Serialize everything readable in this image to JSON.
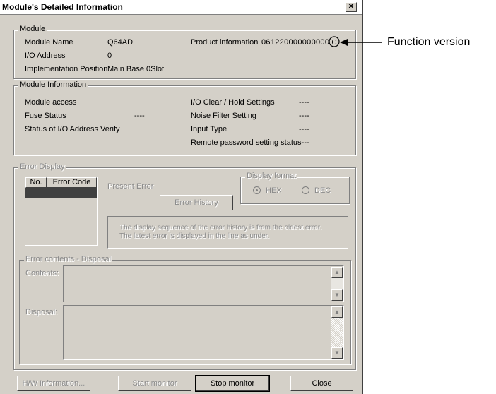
{
  "window": {
    "title": "Module's Detailed Information",
    "close_glyph": "✕"
  },
  "module": {
    "legend": "Module",
    "name_label": "Module Name",
    "name_value": "Q64AD",
    "io_label": "I/O Address",
    "io_value": "0",
    "impl_label": "Implementation Position",
    "impl_value": "Main Base  0Slot",
    "product_label": "Product information",
    "product_value": "061220000000000",
    "version_letter": "C"
  },
  "module_info": {
    "legend": "Module Information",
    "access_label": "Module access",
    "access_value": "",
    "fuse_label": "Fuse Status",
    "fuse_value": "----",
    "verify_label": "Status of I/O Address Verify",
    "verify_value": "",
    "ioclear_label": "I/O Clear / Hold Settings",
    "ioclear_value": "----",
    "noise_label": "Noise Filter Setting",
    "noise_value": "----",
    "input_label": "Input Type",
    "input_value": "----",
    "remote_label": "Remote password setting status",
    "remote_value": "----"
  },
  "error_display": {
    "legend": "Error Display",
    "col_no": "No.",
    "col_code": "Error Code",
    "present_error_label": "Present Error",
    "display_format_legend": "Display format",
    "hex_label": "HEX",
    "dec_label": "DEC",
    "error_history_button": "Error History",
    "note_line1": "The display sequence of the error history is from the oldest error.",
    "note_line2": "The latest error is displayed in the line as under."
  },
  "error_contents": {
    "legend": "Error contents - Disposal",
    "contents_label": "Contents:",
    "disposal_label": "Disposal:"
  },
  "footer": {
    "hw_button": "H/W Information...",
    "start_button": "Start monitor",
    "stop_button": "Stop monitor",
    "close_button": "Close"
  },
  "annotation": {
    "function_version": "Function version"
  }
}
